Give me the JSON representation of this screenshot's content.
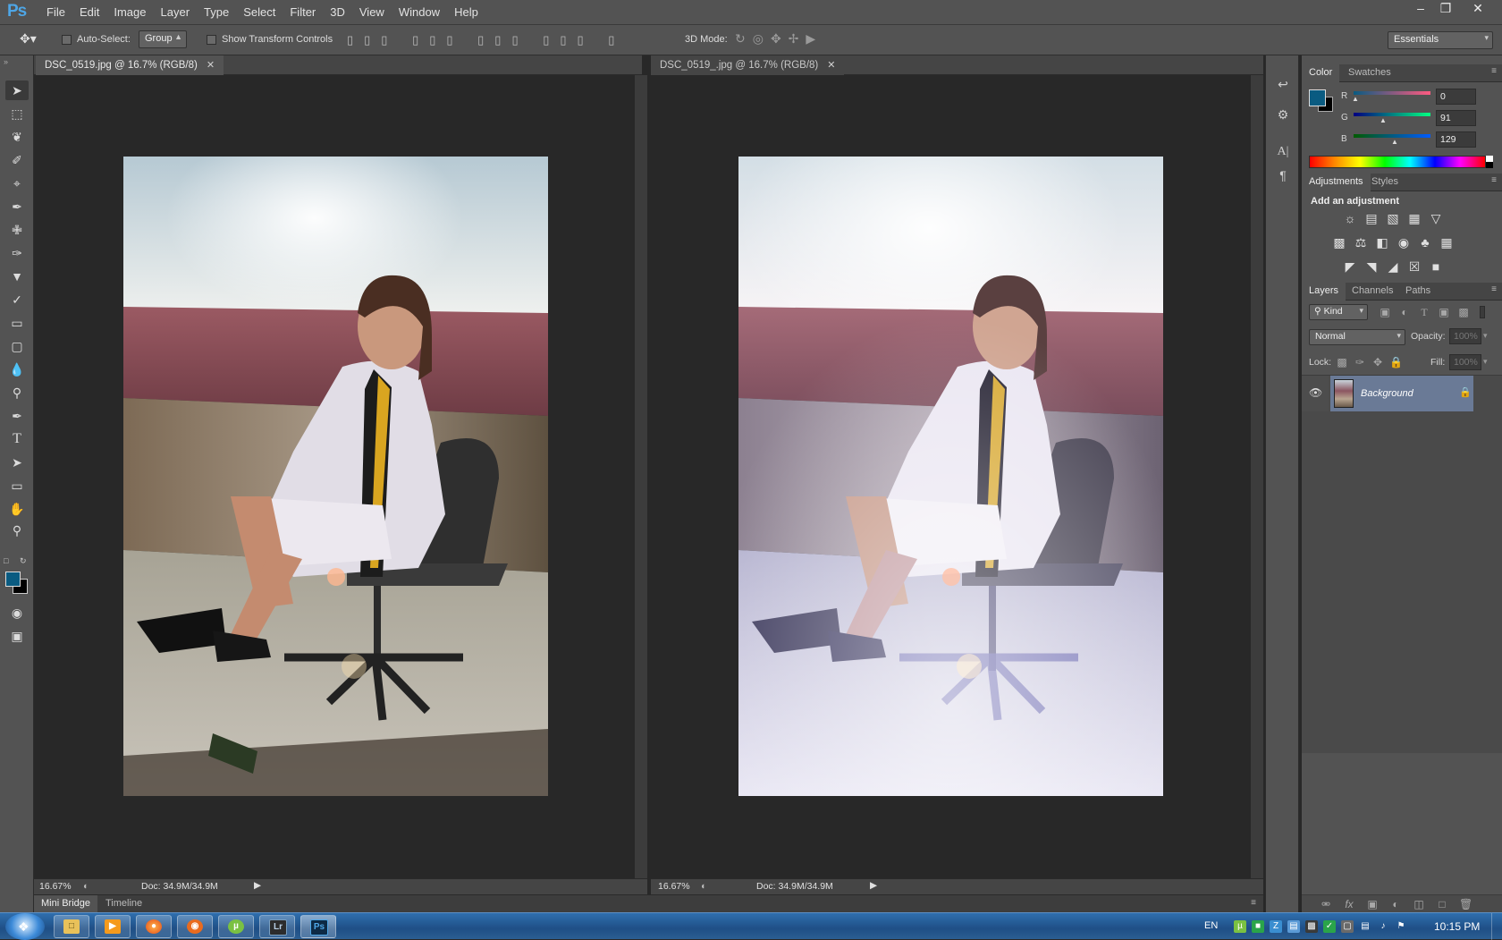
{
  "app": {
    "logo": "Ps"
  },
  "menu": [
    "File",
    "Edit",
    "Image",
    "Layer",
    "Type",
    "Select",
    "Filter",
    "3D",
    "View",
    "Window",
    "Help"
  ],
  "options": {
    "auto_select_label": "Auto-Select:",
    "group_value": "Group",
    "transform_label": "Show Transform Controls",
    "mode_3d_label": "3D Mode:",
    "workspace": "Essentials"
  },
  "documents": [
    {
      "tab": "DSC_0519.jpg @ 16.7% (RGB/8)",
      "zoom": "16.67%",
      "doc_info": "Doc: 34.9M/34.9M"
    },
    {
      "tab": "DSC_0519_.jpg @ 16.7% (RGB/8)",
      "zoom": "16.67%",
      "doc_info": "Doc: 34.9M/34.9M"
    }
  ],
  "bottom_tabs": [
    "Mini Bridge",
    "Timeline"
  ],
  "color_panel": {
    "tabs": [
      "Color",
      "Swatches"
    ],
    "foreground": "#0a5b81",
    "channels": [
      {
        "label": "R",
        "value": "0",
        "fraction": 0.0
      },
      {
        "label": "G",
        "value": "91",
        "fraction": 0.357
      },
      {
        "label": "B",
        "value": "129",
        "fraction": 0.506
      }
    ]
  },
  "adjustments_panel": {
    "tabs": [
      "Adjustments",
      "Styles"
    ],
    "heading": "Add an adjustment",
    "icons": [
      "brightness-contrast-icon",
      "levels-icon",
      "curves-icon",
      "exposure-icon",
      "vibrance-icon",
      "hue-saturation-icon",
      "color-balance-icon",
      "black-white-icon",
      "photo-filter-icon",
      "channel-mixer-icon",
      "color-lookup-icon",
      "invert-icon",
      "posterize-icon",
      "threshold-icon",
      "selective-color-icon",
      "gradient-map-icon"
    ]
  },
  "layers_panel": {
    "tabs": [
      "Layers",
      "Channels",
      "Paths"
    ],
    "filter_kind": "Kind",
    "blend_mode": "Normal",
    "opacity_label": "Opacity:",
    "opacity_value": "100%",
    "lock_label": "Lock:",
    "fill_label": "Fill:",
    "fill_value": "100%",
    "layers": [
      {
        "name": "Background",
        "visible": true,
        "locked": true
      }
    ]
  },
  "taskbar": {
    "language": "EN",
    "time": "10:15 PM",
    "apps": [
      "windows-explorer",
      "media-player",
      "firefox",
      "app-orange",
      "utorrent",
      "lightroom",
      "photoshop"
    ]
  }
}
